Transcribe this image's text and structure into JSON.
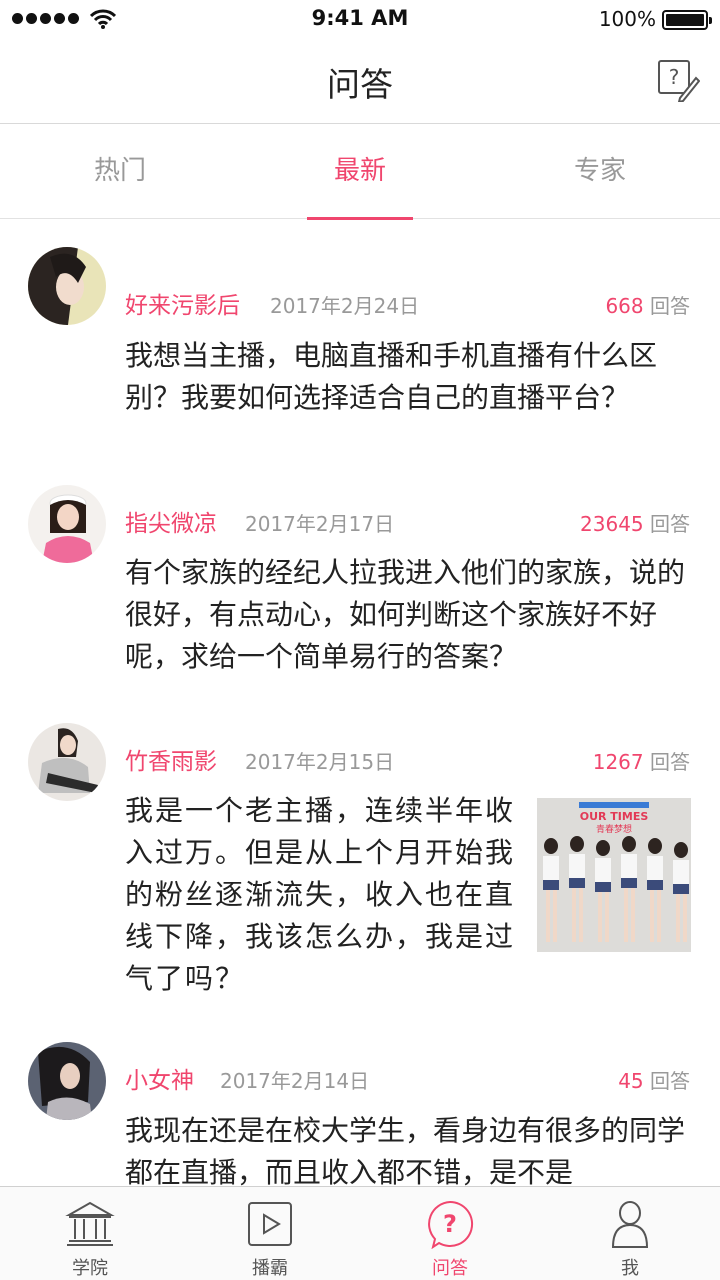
{
  "status_bar": {
    "time": "9:41 AM",
    "battery": "100%"
  },
  "nav": {
    "title": "问答"
  },
  "tabs": [
    {
      "label": "热门",
      "active": false
    },
    {
      "label": "最新",
      "active": true
    },
    {
      "label": "专家",
      "active": false
    }
  ],
  "questions": [
    {
      "author": "好来污影后",
      "date": "2017年2月24日",
      "answers": "668",
      "answer_label": "回答",
      "text": "我想当主播，电脑直播和手机直播有什么区别？我要如何选择适合自己的直播平台？"
    },
    {
      "author": "指尖微凉",
      "date": "2017年2月17日",
      "answers": "23645",
      "answer_label": "回答",
      "text": "有个家族的经纪人拉我进入他们的家族，说的很好，有点动心，如何判断这个家族好不好呢，求给一个简单易行的答案？"
    },
    {
      "author": "竹香雨影",
      "date": "2017年2月15日",
      "answers": "1267",
      "answer_label": "回答",
      "text": "我是一个老主播，连续半年收入过万。但是从上个月开始我的粉丝逐渐流失，收入也在直线下降，我该怎么办，我是过气了吗？",
      "image_caption": "OUR TIMES",
      "image_subcaption": "青春梦想"
    },
    {
      "author": "小女神",
      "date": "2017年2月14日",
      "answers": "45",
      "answer_label": "回答",
      "text": "我现在还是在校大学生，看身边有很多的同学都在直播，而且收入都不错，是不是"
    }
  ],
  "tabbar": [
    {
      "label": "学院",
      "icon": "academy-icon",
      "active": false
    },
    {
      "label": "播霸",
      "icon": "play-icon",
      "active": false
    },
    {
      "label": "问答",
      "icon": "question-icon",
      "active": true
    },
    {
      "label": "我",
      "icon": "profile-icon",
      "active": false
    }
  ],
  "colors": {
    "accent": "#f0466e",
    "muted": "#999999",
    "text": "#222222"
  }
}
